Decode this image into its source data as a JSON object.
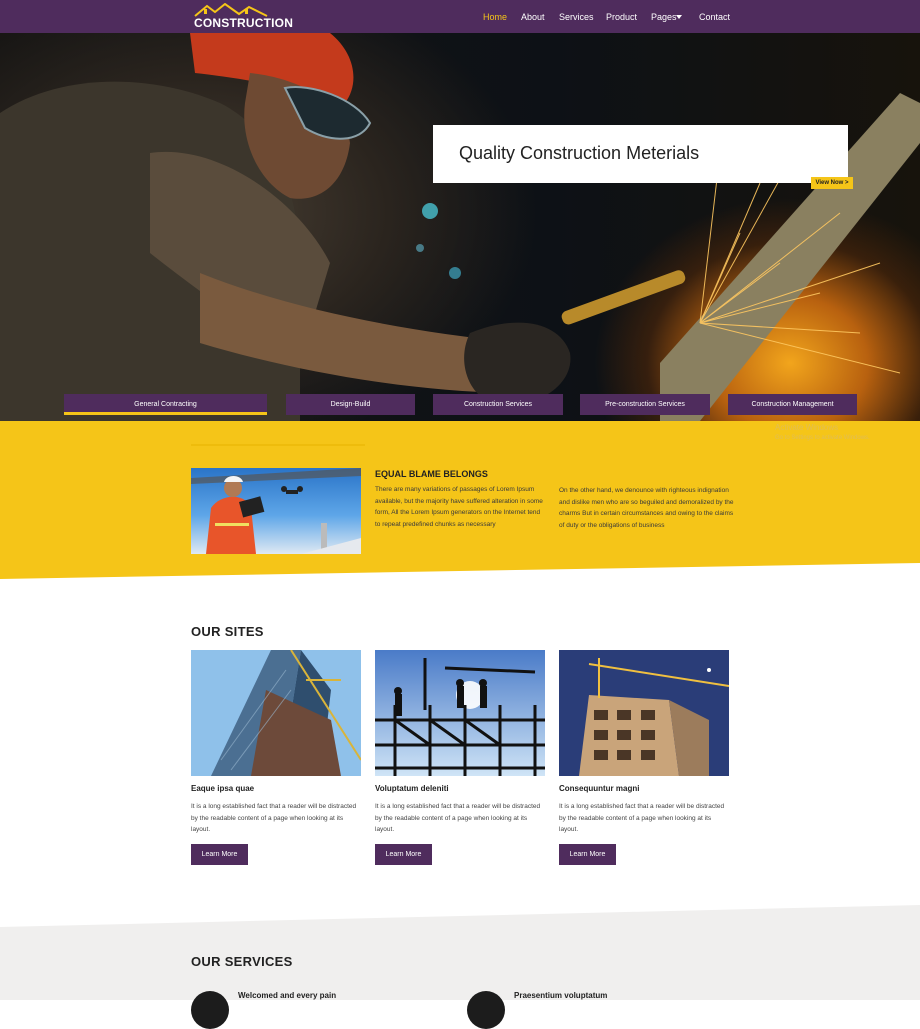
{
  "brand": {
    "logo_text": "CONSTRUCTION"
  },
  "nav": {
    "items": [
      {
        "label": "Home"
      },
      {
        "label": "About"
      },
      {
        "label": "Services"
      },
      {
        "label": "Product"
      },
      {
        "label": "Pages"
      },
      {
        "label": "Contact"
      }
    ],
    "active": "Home"
  },
  "hero": {
    "caption_title": "Quality Construction Meterials",
    "cta_label": "View Now >"
  },
  "service_tabs": [
    {
      "label": "General Contracting"
    },
    {
      "label": "Design-Build"
    },
    {
      "label": "Construction Services"
    },
    {
      "label": "Pre-construction Services"
    },
    {
      "label": "Construction Management"
    }
  ],
  "about": {
    "title": "EQUAL BLAME BELONGS",
    "text_left": "There are many variations of passages of Lorem Ipsum available, but the majority have suffered alteration in some form, All the Lorem Ipsum generators on the Internet tend to repeat predefined chunks as necessary",
    "text_right": "On the other hand, we denounce with righteous indignation and dislike men who are so beguiled and demoralized by the charms But in certain circumstances and owing to the claims of duty or the obligations of business"
  },
  "os_watermark": {
    "line1": "Activate Windows",
    "line2": "Go to Settings to activate Windows."
  },
  "sites": {
    "title": "OUR SITES",
    "cards": [
      {
        "title": "Eaque ipsa quae",
        "text": "It is a long established fact that a reader will be distracted by the readable content of a page when looking at its layout.",
        "button": "Learn More"
      },
      {
        "title": "Voluptatum deleniti",
        "text": "It is a long established fact that a reader will be distracted by the readable content of a page when looking at its layout.",
        "button": "Learn More"
      },
      {
        "title": "Consequuntur magni",
        "text": "It is a long established fact that a reader will be distracted by the readable content of a page when looking at its layout.",
        "button": "Learn More"
      }
    ]
  },
  "services": {
    "title": "OUR SERVICES",
    "items": [
      {
        "title": "Welcomed and every pain"
      },
      {
        "title": "Praesentium voluptatum"
      }
    ]
  },
  "colors": {
    "primary": "#4f2c5d",
    "accent": "#f5c518",
    "grey_bg": "#f0efee"
  }
}
